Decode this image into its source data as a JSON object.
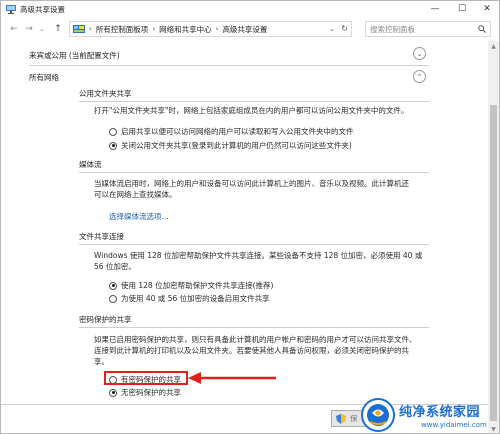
{
  "window": {
    "title": "高级共享设置",
    "minimize_glyph": "—",
    "maximize_glyph": "☐",
    "close_glyph": "✕"
  },
  "nav": {
    "back_glyph": "←",
    "forward_glyph": "→",
    "recent_glyph": "⌄",
    "up_glyph": "↑"
  },
  "address": {
    "breadcrumbs": [
      "所有控制面板项",
      "网络和共享中心",
      "高级共享设置"
    ],
    "separator": "›",
    "dropdown_glyph": "⌄",
    "refresh_glyph": "↻"
  },
  "search": {
    "placeholder": "搜索控制面板"
  },
  "sections": {
    "guest": {
      "label": "来宾或公用 (当前配置文件)",
      "toggle_glyph": "⌄"
    },
    "all_networks": {
      "label": "所有网络",
      "toggle_glyph": "⌃"
    }
  },
  "public_folder": {
    "title": "公用文件夹共享",
    "description": "打开\"公用文件夹共享\"时，网络上包括家庭组成员在内的用户都可以访问公用文件夹中的文件。",
    "options": [
      {
        "label": "启用共享以便可以访问网络的用户可以读取和写入公用文件夹中的文件",
        "checked": false
      },
      {
        "label": "关闭公用文件夹共享(登录到此计算机的用户仍然可以访问这些文件夹)",
        "checked": true
      }
    ]
  },
  "media": {
    "title": "媒体流",
    "description_line1": "当媒体流启用时，网络上的用户和设备可以访问此计算机上的图片、音乐以及视频。此计算机还",
    "description_line2": "可以在网络上查找媒体。",
    "link": "选择媒体流选项..."
  },
  "file_sharing": {
    "title": "文件共享连接",
    "description_line1": "Windows 使用 128 位加密帮助保护文件共享连接。某些设备不支持 128 位加密，必须使用 40 或",
    "description_line2": "56 位加密。",
    "options": [
      {
        "label": "使用 128 位加密帮助保护文件共享连接(推荐)",
        "checked": true
      },
      {
        "label": "为使用 40 或 56 位加密的设备启用文件共享",
        "checked": false
      }
    ]
  },
  "password": {
    "title": "密码保护的共享",
    "description_line1": "如果已启用密码保护的共享，则只有具备此计算机的用户帐户和密码的用户才可以访问共享文件、",
    "description_line2": "连接到此计算机的打印机以及公用文件夹。若要使其他人具备访问权限，必须关闭密码保护的共",
    "description_line3": "享。",
    "options": [
      {
        "label": "有密码保护的共享",
        "checked": false
      },
      {
        "label": "无密码保护的共享",
        "checked": true
      }
    ]
  },
  "footer": {
    "save_label": "保"
  },
  "watermark": {
    "title": "纯净系统家园",
    "url": "www.yidaimei.com"
  },
  "colors": {
    "link": "#1a5fb4",
    "annotation_red": "#e0201d",
    "watermark_blue": "#1e6fd1"
  }
}
